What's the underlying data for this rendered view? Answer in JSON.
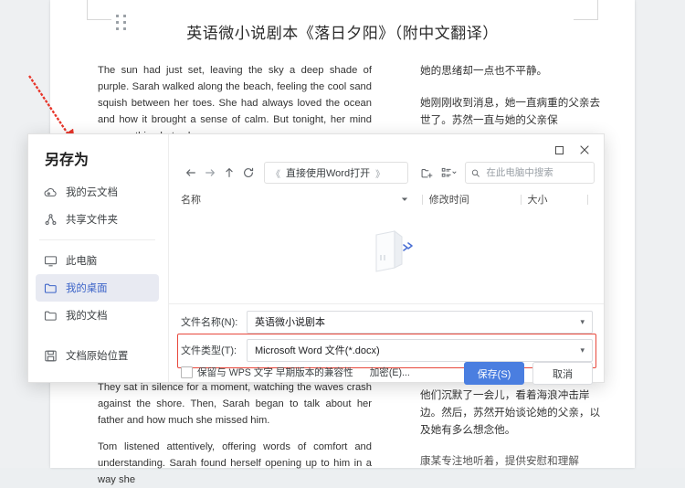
{
  "document": {
    "title": "英语微小说剧本《落日夕阳》（附中文翻译）",
    "paragraphs_en": [
      "The sun had just set, leaving the sky a deep shade of purple. Sarah walked along the beach, feeling the cool sand squish between her toes. She had always loved the ocean and how it brought a sense of calm. But tonight, her mind was anything but calm.",
      "They sat in silence for a moment, watching the waves crash against the shore. Then, Sarah began to talk about her father and how much she missed him.",
      "Tom listened attentively, offering words of comfort and understanding. Sarah found herself opening up to him in a way she"
    ],
    "paragraphs_zh": [
      "她的思绪却一点也不平静。",
      "她刚刚收到消息，她一直病重的父亲去世了。苏然一直与她的父亲保",
      "他们沉默了一会儿，看着海浪冲击岸边。然后，苏然开始谈论她的父亲，以及她有多么想念他。",
      "康某专注地听着，提供安慰和理解"
    ]
  },
  "dialog": {
    "heading": "另存为",
    "nav_items": [
      {
        "label": "我的云文档",
        "icon": "cloud-icon",
        "selected": false
      },
      {
        "label": "共享文件夹",
        "icon": "share-network-icon",
        "selected": false
      },
      {
        "label": "此电脑",
        "icon": "monitor-icon",
        "selected": false
      },
      {
        "label": "我的桌面",
        "icon": "folder-icon",
        "selected": true
      },
      {
        "label": "我的文档",
        "icon": "folder-icon",
        "selected": false
      },
      {
        "label": "文档原始位置",
        "icon": "save-disk-icon",
        "selected": false
      }
    ],
    "window_buttons": {
      "maximize": "maximize-icon",
      "close": "close-icon"
    },
    "nav_buttons": {
      "back": "arrow-left-icon",
      "forward": "arrow-right-icon",
      "up": "arrow-up-icon",
      "refresh": "refresh-icon"
    },
    "breadcrumb": {
      "prefix": "《",
      "location": "直接使用Word打开",
      "suffix": "》"
    },
    "toolbar": {
      "new_folder": "new-folder-icon",
      "view_options": "view-options-icon"
    },
    "search": {
      "placeholder": "在此电脑中搜索",
      "value": "",
      "icon": "search-icon"
    },
    "columns": {
      "name": "名称",
      "modified": "修改时间",
      "size": "大小"
    },
    "empty_state_icon": "empty-folder-illustration",
    "file_name": {
      "label": "文件名称(N):",
      "value": "英语微小说剧本"
    },
    "file_type": {
      "label": "文件类型(T):",
      "value": "Microsoft Word 文件(*.docx)"
    },
    "compat_checkbox": {
      "label": "保留与 WPS 文字 早期版本的兼容性",
      "checked": false
    },
    "encrypt_link": "加密(E)...",
    "save_button": "保存(S)",
    "cancel_button": "取消",
    "highlight_color": "#e8483c",
    "accent_color": "#4a7ee0"
  }
}
